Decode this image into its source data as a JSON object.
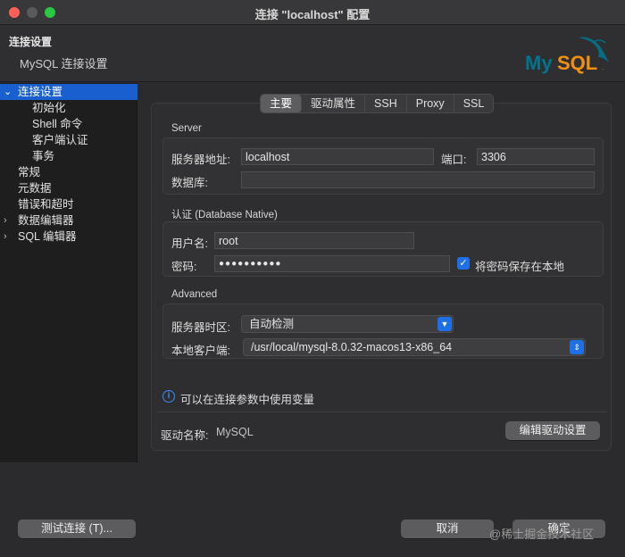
{
  "window": {
    "title": "连接 \"localhost\" 配置"
  },
  "header": {
    "title": "连接设置",
    "subtitle": "MySQL 连接设置",
    "logo_text": "MySQL"
  },
  "sidebar": {
    "items": [
      {
        "label": "连接设置",
        "chevron": "⌄",
        "selected": true
      },
      {
        "label": "初始化"
      },
      {
        "label": "Shell 命令"
      },
      {
        "label": "客户端认证"
      },
      {
        "label": "事务"
      },
      {
        "label": "常规"
      },
      {
        "label": "元数据"
      },
      {
        "label": "错误和超时"
      },
      {
        "label": "数据编辑器",
        "chevron": "›"
      },
      {
        "label": "SQL 编辑器",
        "chevron": "›"
      }
    ]
  },
  "tabs": [
    {
      "label": "主要",
      "active": true
    },
    {
      "label": "驱动属性"
    },
    {
      "label": "SSH"
    },
    {
      "label": "Proxy"
    },
    {
      "label": "SSL"
    }
  ],
  "server": {
    "section": "Server",
    "host_label": "服务器地址:",
    "host_value": "localhost",
    "port_label": "端口:",
    "port_value": "3306",
    "db_label": "数据库:",
    "db_value": ""
  },
  "auth": {
    "section": "认证 (Database Native)",
    "user_label": "用户名:",
    "user_value": "root",
    "password_label": "密码:",
    "password_value": "●●●●●●●●●●",
    "save_password_label": "将密码保存在本地",
    "save_password_checked": true
  },
  "advanced": {
    "section": "Advanced",
    "timezone_label": "服务器时区:",
    "timezone_value": "自动检测",
    "client_label": "本地客户端:",
    "client_value": "/usr/local/mysql-8.0.32-macos13-x86_64"
  },
  "info": {
    "text": "可以在连接参数中使用变量"
  },
  "driver": {
    "label": "驱动名称:",
    "value": "MySQL",
    "edit_button": "编辑驱动设置"
  },
  "footer": {
    "test_button": "测试连接 (T)...",
    "cancel_button": "取消",
    "ok_button": "确定"
  },
  "watermark": "@稀土掘金技术社区",
  "colors": {
    "accent": "#1f6fe6",
    "selection": "#1a5fd0",
    "logo_teal": "#00758f",
    "logo_orange": "#f29111"
  }
}
